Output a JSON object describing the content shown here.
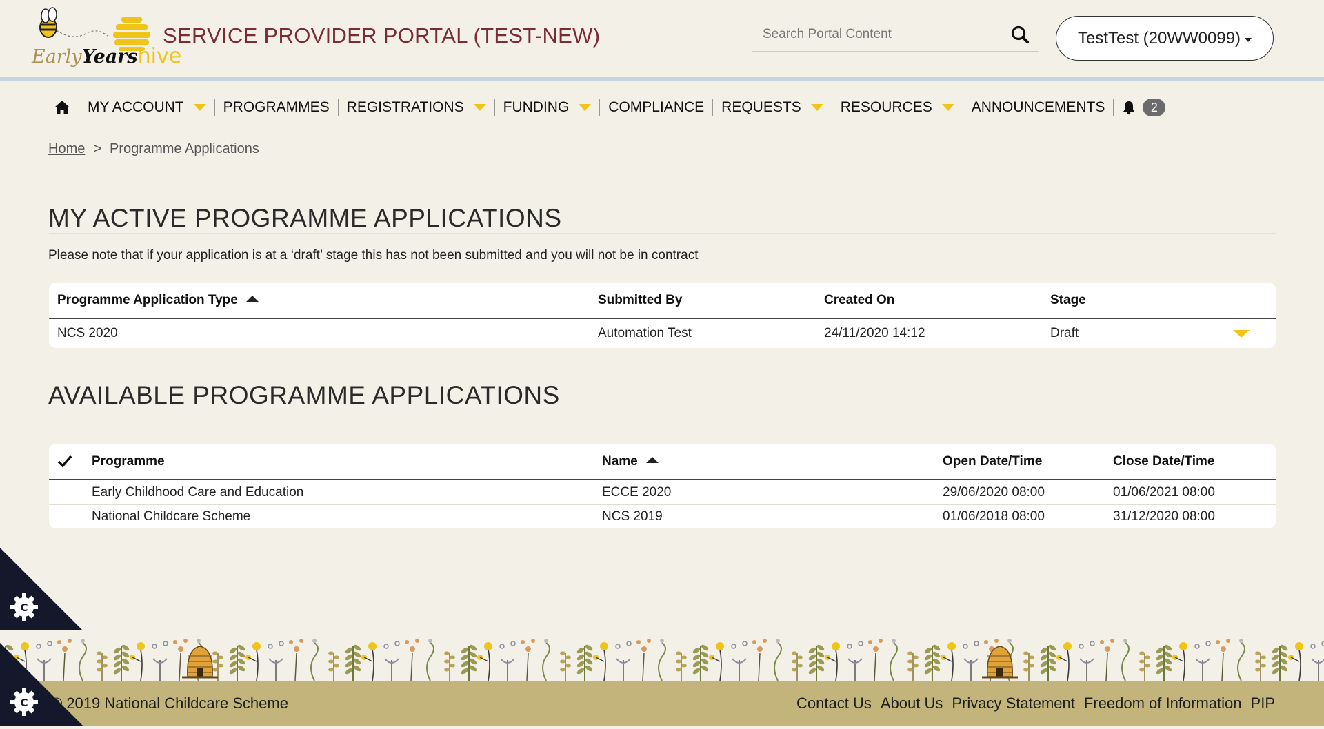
{
  "header": {
    "portal_title": "SERVICE PROVIDER PORTAL (TEST-NEW)",
    "logo_text_early": "Early",
    "logo_text_years": "Years",
    "logo_text_hive": "hive",
    "search_placeholder": "Search Portal Content",
    "user_label": "TestTest (20WW0099)"
  },
  "nav": {
    "items": [
      {
        "label": "MY ACCOUNT",
        "dropdown": true
      },
      {
        "label": "PROGRAMMES",
        "dropdown": false
      },
      {
        "label": "REGISTRATIONS",
        "dropdown": true
      },
      {
        "label": "FUNDING",
        "dropdown": true
      },
      {
        "label": "COMPLIANCE",
        "dropdown": false
      },
      {
        "label": "REQUESTS",
        "dropdown": true
      },
      {
        "label": "RESOURCES",
        "dropdown": true
      },
      {
        "label": "ANNOUNCEMENTS",
        "dropdown": false
      }
    ],
    "notification_count": "2"
  },
  "breadcrumb": {
    "home": "Home",
    "separator": ">",
    "current": "Programme Applications"
  },
  "active": {
    "title": "MY ACTIVE PROGRAMME APPLICATIONS",
    "note": "Please note that if your application is at a ‘draft’ stage this has not been submitted and you will not be in contract",
    "headers": [
      "Programme Application Type",
      "Submitted By",
      "Created On",
      "Stage"
    ],
    "rows": [
      {
        "type": "NCS 2020",
        "submitted_by": "Automation Test",
        "created_on": "24/11/2020 14:12",
        "stage": "Draft"
      }
    ]
  },
  "available": {
    "title": "AVAILABLE PROGRAMME APPLICATIONS",
    "headers": [
      "Programme",
      "Name",
      "Open Date/Time",
      "Close Date/Time"
    ],
    "rows": [
      {
        "programme": "Early Childhood Care and Education",
        "name": "ECCE 2020",
        "open": "29/06/2020 08:00",
        "close": "01/06/2021 08:00"
      },
      {
        "programme": "National Childcare Scheme",
        "name": "NCS 2019",
        "open": "01/06/2018 08:00",
        "close": "31/12/2020 08:00"
      }
    ]
  },
  "footer": {
    "copyright": "© 2019 National Childcare Scheme",
    "links": [
      "Contact Us",
      "About Us",
      "Privacy Statement",
      "Freedom of Information",
      "PIP"
    ]
  },
  "colors": {
    "title_maroon": "#7a2b34",
    "accent_yellow": "#f0c419",
    "footer_bg": "#c2b47a",
    "page_bg": "#f3f0e8"
  }
}
